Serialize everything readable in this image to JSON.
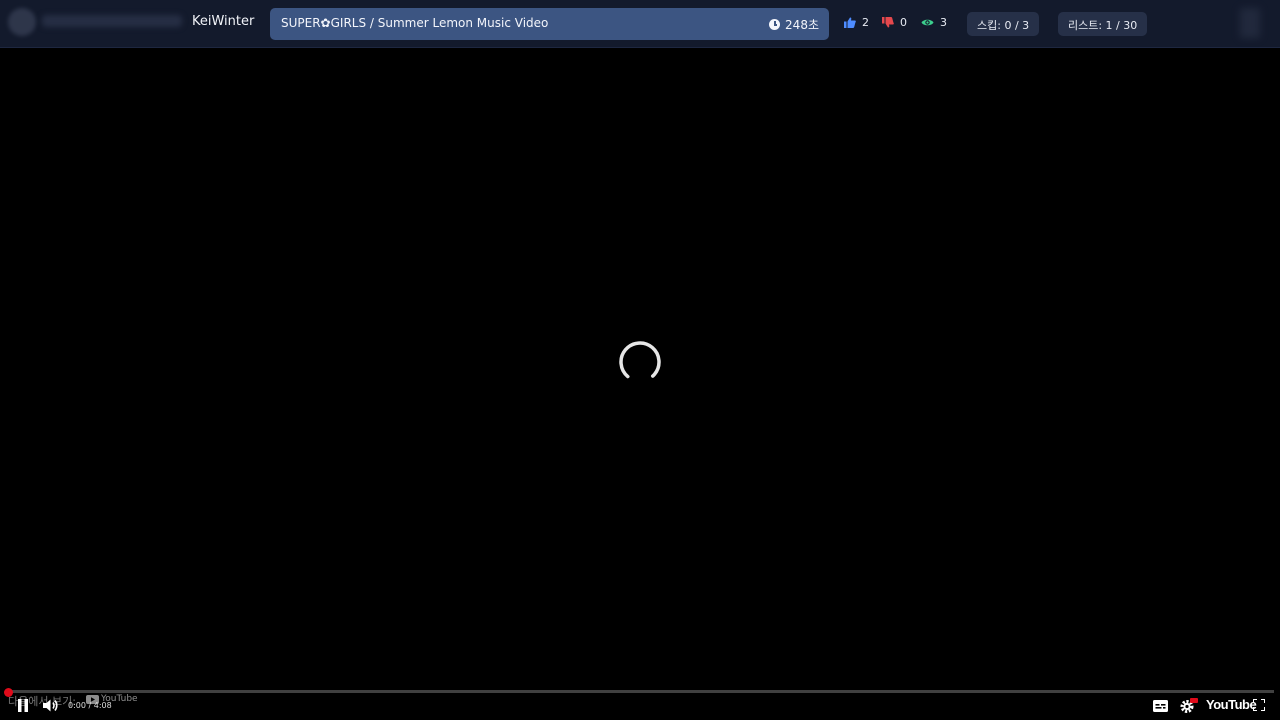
{
  "header": {
    "username": "KeiWinter",
    "video_title": "SUPER✿GIRLS / Summer Lemon Music Video",
    "timer": "248초",
    "likes": "2",
    "dislikes": "0",
    "views": "3",
    "skip_label": "스킵: 0 / 3",
    "list_label": "리스트: 1 / 30",
    "colors": {
      "like": "#4e8cff",
      "dislike": "#e5484d",
      "view": "#3ccf8e",
      "title_bg": "#3c5582"
    }
  },
  "player": {
    "state": "loading",
    "time_display": "0:00 / 4:08",
    "next_watch_label": "다음에서 보기:",
    "youtube_small": "YouTube",
    "youtube_logo": "YouTube",
    "progress": 0,
    "icons": [
      "pause-icon",
      "volume-icon",
      "subtitles-icon",
      "settings-icon",
      "fullscreen-icon"
    ]
  }
}
